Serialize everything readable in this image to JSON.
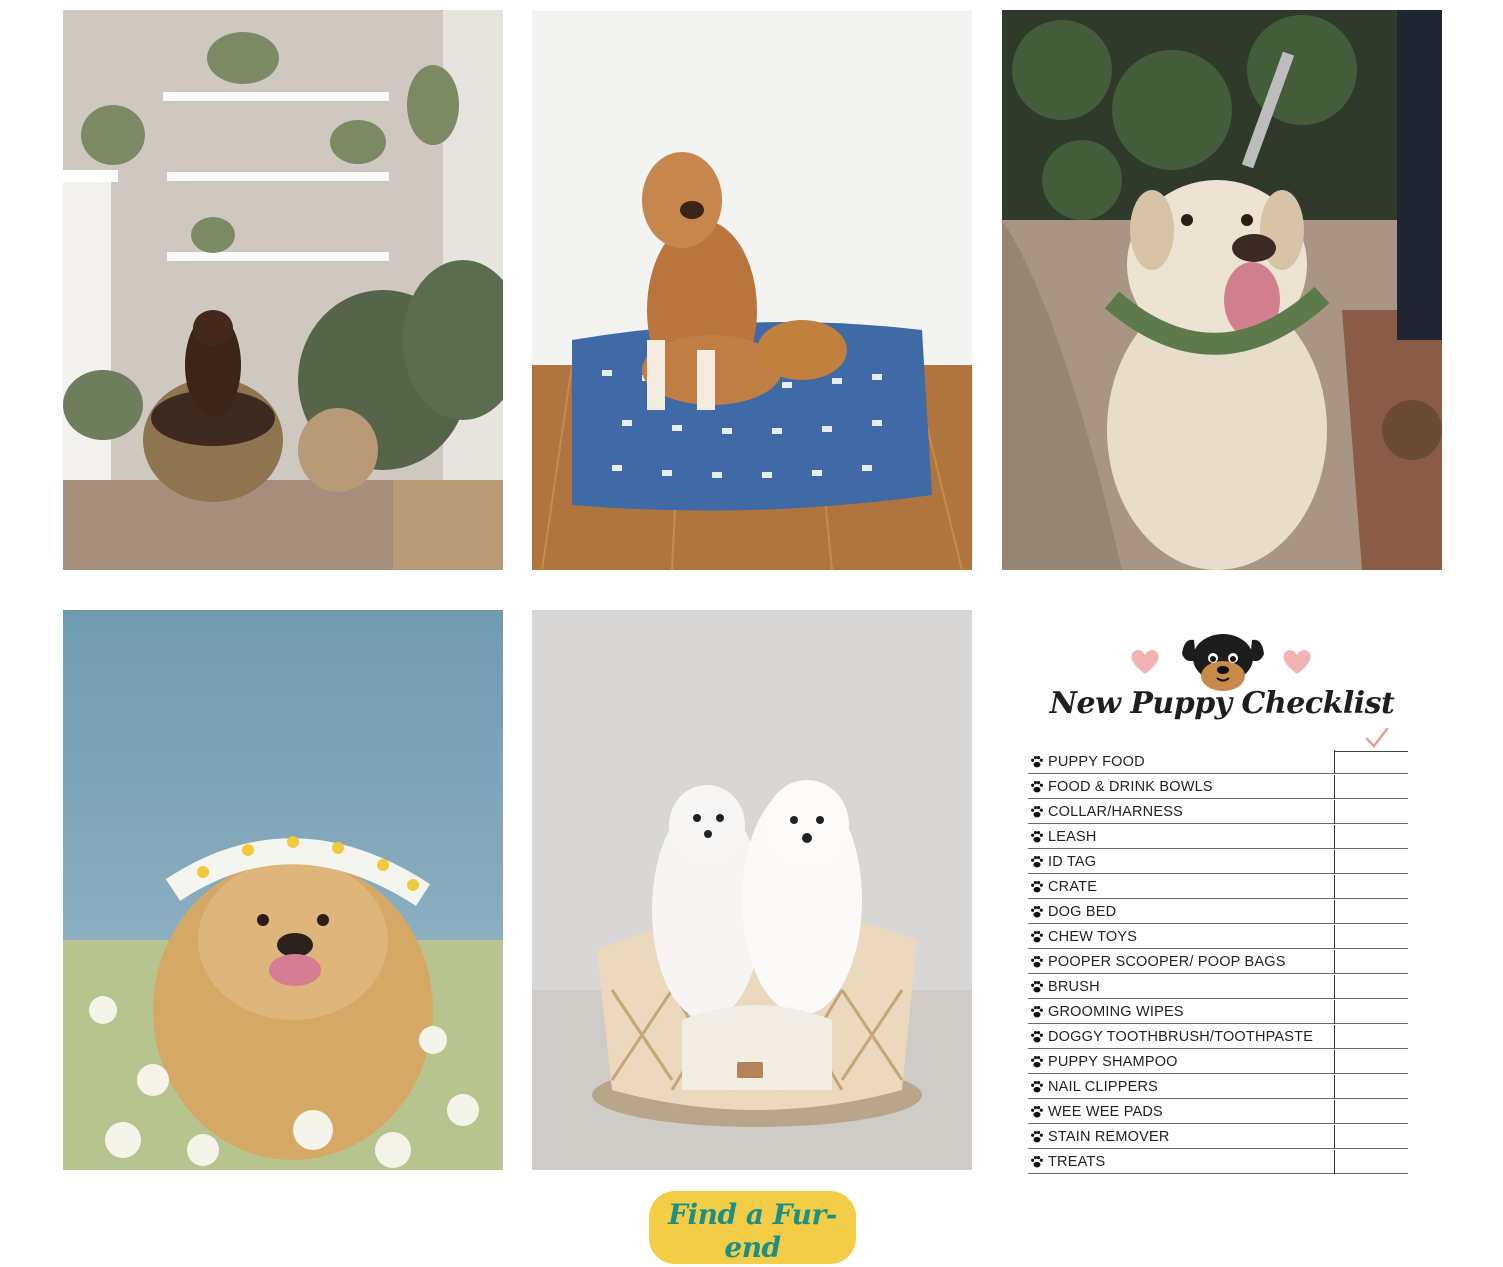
{
  "checklist": {
    "title": "New Puppy Checklist",
    "items": [
      "PUPPY FOOD",
      "FOOD & DRINK BOWLS",
      "COLLAR/HARNESS",
      "LEASH",
      "ID TAG",
      "CRATE",
      "DOG BED",
      "CHEW TOYS",
      "POOPER SCOOPER/ POOP BAGS",
      "BRUSH",
      "GROOMING WIPES",
      "DOGGY TOOTHBRUSH/TOOTHPASTE",
      "PUPPY SHAMPOO",
      "NAIL CLIPPERS",
      "WEE WEE PADS",
      "STAIN REMOVER",
      "TREATS"
    ]
  },
  "cta": {
    "label": "Find a Fur-end"
  },
  "colors": {
    "button_bg": "#f4cd47",
    "button_text": "#1e8f84",
    "heart": "#f2b3b3",
    "tick": "#e89a9a"
  }
}
